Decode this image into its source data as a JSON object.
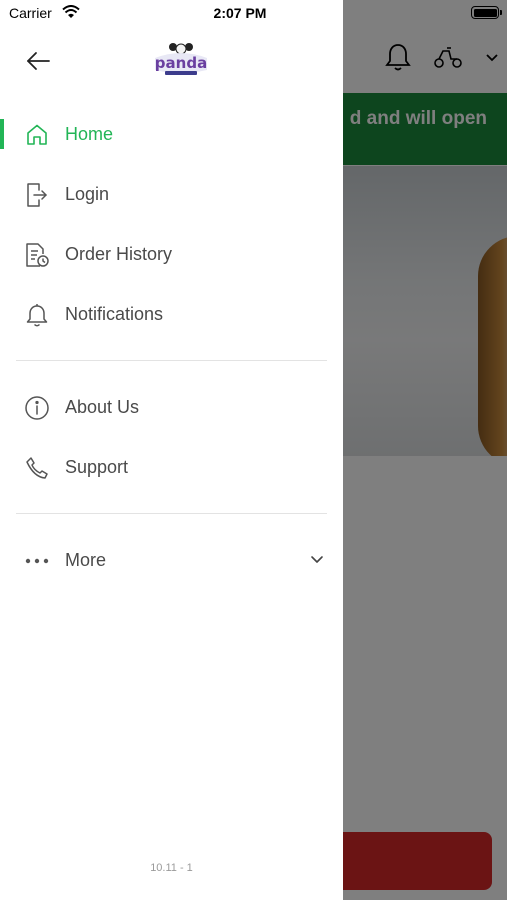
{
  "status_bar": {
    "carrier": "Carrier",
    "time": "2:07 PM"
  },
  "background": {
    "banner_text": "d and will open",
    "banner_color": "#1a8b3c",
    "cta_color": "#d62828"
  },
  "drawer": {
    "logo_icon": "panda-logo",
    "back_icon": "arrow-left-icon",
    "menu_primary": [
      {
        "label": "Home",
        "icon": "home-icon",
        "active": true
      },
      {
        "label": "Login",
        "icon": "login-icon",
        "active": false
      },
      {
        "label": "Order History",
        "icon": "order-history-icon",
        "active": false
      },
      {
        "label": "Notifications",
        "icon": "bell-icon",
        "active": false
      }
    ],
    "menu_secondary": [
      {
        "label": "About Us",
        "icon": "info-icon"
      },
      {
        "label": "Support",
        "icon": "phone-icon"
      }
    ],
    "more": {
      "label": "More",
      "icon": "ellipsis-icon",
      "expanded": false
    },
    "version": "10.11 - 1"
  },
  "colors": {
    "accent": "#22b556",
    "text": "#4a4a4a",
    "divider": "#e3e3e3"
  }
}
